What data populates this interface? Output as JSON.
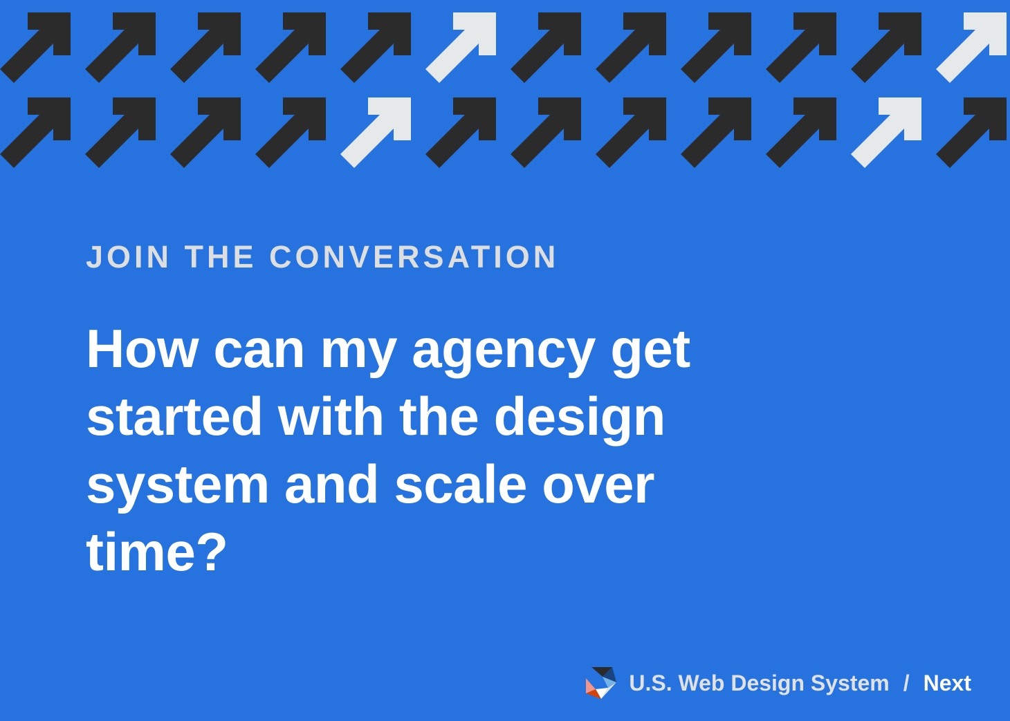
{
  "theme": {
    "background": "#2672de",
    "arrow_dark": "#2b2b2b",
    "arrow_light": "#e6e9ea"
  },
  "pattern": {
    "icon": "arrow-up-right-icon",
    "rows": [
      [
        "dark",
        "dark",
        "dark",
        "dark",
        "dark",
        "light",
        "dark",
        "dark",
        "dark",
        "dark",
        "dark",
        "light"
      ],
      [
        "dark",
        "dark",
        "dark",
        "dark",
        "light",
        "dark",
        "dark",
        "dark",
        "dark",
        "dark",
        "light",
        "dark"
      ]
    ]
  },
  "eyebrow": "JOIN THE CONVERSATION",
  "headline": "How can my agency get started with the design system and scale over time?",
  "footer": {
    "logo_icon": "uswds-logo-icon",
    "brand": "U.S. Web Design System",
    "separator": "/",
    "next_label": "Next"
  }
}
